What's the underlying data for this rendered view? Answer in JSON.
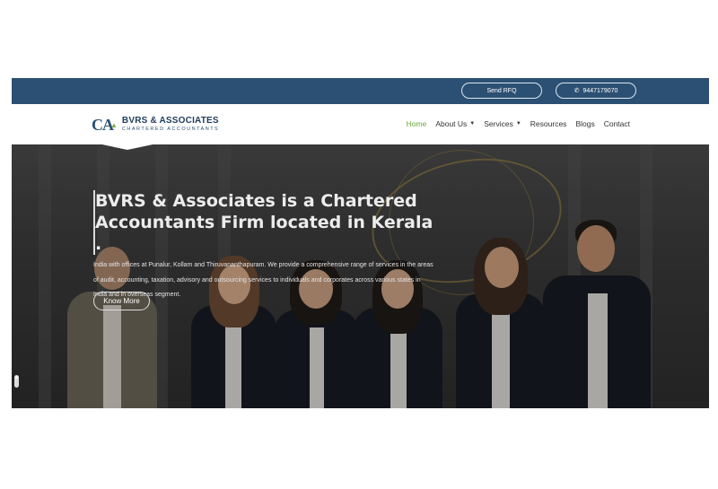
{
  "topbar": {
    "rfq_label": "Send RFQ",
    "phone_label": "9447179070",
    "phone_icon": "phone-icon"
  },
  "logo": {
    "mark": "CA",
    "title": "BVRS & ASSOCIATES",
    "subtitle": "CHARTERED ACCOUNTANTS"
  },
  "nav": {
    "items": [
      {
        "label": "Home",
        "active": true
      },
      {
        "label": "About Us",
        "dropdown": true
      },
      {
        "label": "Services",
        "dropdown": true
      },
      {
        "label": "Resources"
      },
      {
        "label": "Blogs"
      },
      {
        "label": "Contact"
      }
    ],
    "accent": "#6aa83c"
  },
  "hero": {
    "title_line1": "BVRS & Associates is a Chartered",
    "title_line2": "Accountants Firm located in Kerala .",
    "description": "India with offices at Punalur, Kollam and Thiruvananthapuram. We provide a comprehensive range of services in the areas of audit, accounting, taxation, advisory and outsourcing services to individuals and corporates across various states in India and in overseas segment.",
    "button_label": "Know More"
  },
  "colors": {
    "topbar": "#2c5073",
    "brand": "#1f3c5a"
  }
}
